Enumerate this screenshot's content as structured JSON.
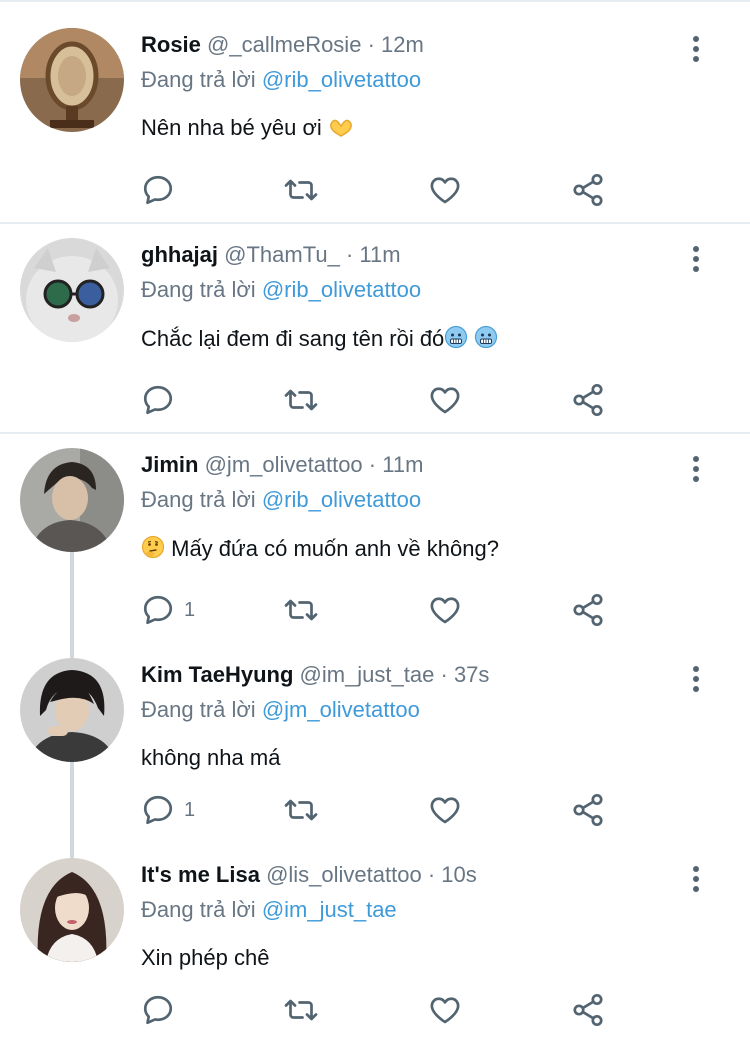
{
  "tweets": [
    {
      "name": "Rosie",
      "handle": "@_callmeRosie",
      "time": "12m",
      "reply_prefix": "Đang trả lời",
      "reply_to": "@rib_olivetattoo",
      "text": "Nên nha bé yêu ơi",
      "emoji_after": "heart-hands-emoji",
      "reply_count": ""
    },
    {
      "name": "ghhajaj",
      "handle": "@ThamTu_",
      "time": "11m",
      "reply_prefix": "Đang trả lời",
      "reply_to": "@rib_olivetattoo",
      "text": "Chắc lại đem đi sang tên rồi đó",
      "emoji_after": "cold-face-emoji",
      "reply_count": ""
    },
    {
      "name": "Jimin",
      "handle": "@jm_olivetattoo",
      "time": "11m",
      "reply_prefix": "Đang trả lời",
      "reply_to": "@rib_olivetattoo",
      "text": "Mấy đứa có muốn anh về không?",
      "emoji_before": "thinking-face-emoji",
      "reply_count": "1"
    },
    {
      "name": "Kim TaeHyung",
      "handle": "@im_just_tae",
      "time": "37s",
      "reply_prefix": "Đang trả lời",
      "reply_to": "@jm_olivetattoo",
      "text": "không nha má",
      "reply_count": "1"
    },
    {
      "name": "It's me Lisa",
      "handle": "@lis_olivetattoo",
      "time": "10s",
      "reply_prefix": "Đang trả lời",
      "reply_to": "@im_just_tae",
      "text": "Xin phép chê",
      "reply_count": ""
    }
  ],
  "separator": "·",
  "colors": {
    "accent": "#3f9ad9",
    "muted": "#687684",
    "divider": "#e6ecf0"
  }
}
